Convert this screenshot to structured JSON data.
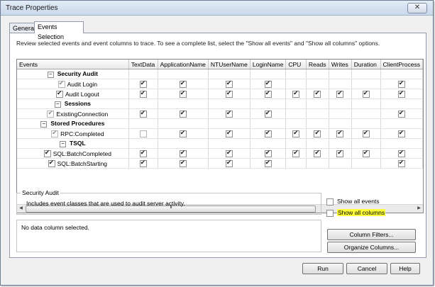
{
  "window": {
    "title": "Trace Properties",
    "close_glyph": "✕"
  },
  "tabs": [
    {
      "label": "General"
    },
    {
      "label": "Events Selection"
    }
  ],
  "instruction": "Review selected events and event columns to trace. To see a complete list, select the \"Show all events\" and \"Show all columns\" options.",
  "grid": {
    "columns": [
      "Events",
      "TextData",
      "ApplicationName",
      "NTUserName",
      "LoginName",
      "CPU",
      "Reads",
      "Writes",
      "Duration",
      "ClientProcess"
    ],
    "rows": [
      {
        "type": "category",
        "expander": "−",
        "name": "Security Audit"
      },
      {
        "type": "event",
        "name": "Audit Login",
        "enabled": true,
        "dim": true,
        "cells": [
          true,
          true,
          true,
          true,
          null,
          null,
          null,
          null,
          true
        ]
      },
      {
        "type": "event",
        "name": "Audit Logout",
        "enabled": true,
        "dim": false,
        "cells": [
          true,
          true,
          true,
          true,
          true,
          true,
          true,
          true,
          true
        ]
      },
      {
        "type": "category",
        "expander": "−",
        "name": "Sessions"
      },
      {
        "type": "event",
        "name": "ExistingConnection",
        "enabled": true,
        "dim": true,
        "cells": [
          true,
          true,
          true,
          true,
          null,
          null,
          null,
          null,
          true
        ]
      },
      {
        "type": "category",
        "expander": "−",
        "name": "Stored Procedures"
      },
      {
        "type": "event",
        "name": "RPC:Completed",
        "enabled": true,
        "dim": true,
        "cells": [
          false,
          true,
          true,
          true,
          true,
          true,
          true,
          true,
          true
        ]
      },
      {
        "type": "category",
        "expander": "−",
        "name": "TSQL"
      },
      {
        "type": "event",
        "name": "SQL:BatchCompleted",
        "enabled": true,
        "dim": false,
        "cells": [
          true,
          true,
          true,
          true,
          true,
          true,
          true,
          true,
          true
        ]
      },
      {
        "type": "event",
        "name": "SQL:BatchStarting",
        "enabled": true,
        "dim": false,
        "cells": [
          true,
          true,
          true,
          true,
          null,
          null,
          null,
          null,
          true
        ]
      }
    ],
    "scroll_grip": "III"
  },
  "description": {
    "title": "Security Audit",
    "text": "Includes event classes that are used to audit server activity."
  },
  "column_info": {
    "text": "No data column selected."
  },
  "options": {
    "show_all_events": {
      "label": "Show all events",
      "checked": false
    },
    "show_all_columns": {
      "label": "Show all columns",
      "checked": false
    }
  },
  "buttons": {
    "column_filters": "Column Filters...",
    "organize_columns": "Organize Columns...",
    "run": "Run",
    "cancel": "Cancel",
    "help": "Help"
  },
  "colors": {
    "highlight": "#ffff3a",
    "title_bar": "#c9d8ea"
  }
}
